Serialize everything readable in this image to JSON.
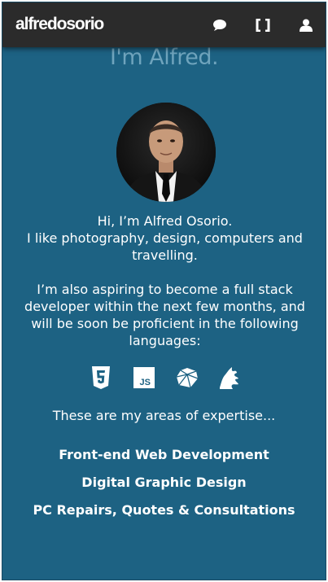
{
  "navbar": {
    "brand": "alfredosorio",
    "icons": [
      "chat-icon",
      "code-brackets-icon",
      "user-icon"
    ]
  },
  "hero": {
    "title": "I'm Alfred.",
    "avatar_alt": "Photo of Alfred Osorio"
  },
  "intro": {
    "line1": "Hi, I’m Alfred Osorio.",
    "line2": "I like photography, design, computers and travelling.",
    "paragraph2": "I’m also aspiring to become a full stack developer within the next few months, and will be soon be proficient in the following languages:"
  },
  "languages": [
    {
      "icon": "html5-icon",
      "label": "5"
    },
    {
      "icon": "javascript-icon",
      "label": "JS"
    },
    {
      "icon": "ruby-icon",
      "label": ""
    },
    {
      "icon": "sass-icon",
      "label": ""
    }
  ],
  "expertise": {
    "lead": "These are my areas of expertise...",
    "items": [
      "Front-end Web Development",
      "Digital Graphic Design",
      "PC Repairs, Quotes & Consultations"
    ]
  },
  "colors": {
    "background": "#1d6283",
    "navbar": "#2b2b2b",
    "title": "#6fa4bd",
    "text": "#ffffff"
  }
}
